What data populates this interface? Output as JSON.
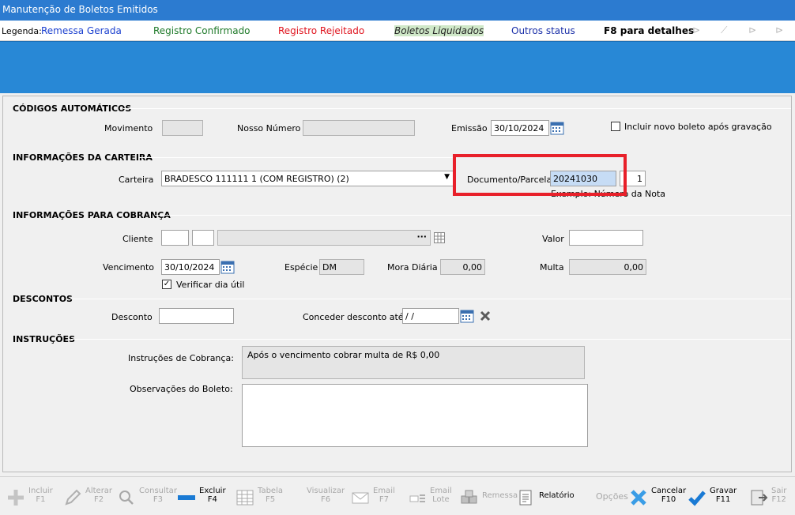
{
  "window": {
    "title": "Manutenção de Boletos Emitidos"
  },
  "legend": {
    "label": "Legenda:",
    "items": [
      {
        "text": "Remessa Gerada",
        "color": "#1a3fcf"
      },
      {
        "text": "Registro Confirmado",
        "color": "#1f7a2a"
      },
      {
        "text": "Registro Rejeitado",
        "color": "#e0141e"
      },
      {
        "text": "Boletos Liquidados",
        "color": "#222222"
      },
      {
        "text": "Outros status",
        "color": "#1a2fa8"
      }
    ],
    "hint": "F8 para detalhes"
  },
  "sections": {
    "codigos": "CÓDIGOS AUTOMÁTICOS",
    "carteira": "INFORMAÇÕES DA CARTEIRA",
    "cobranca": "INFORMAÇÕES PARA COBRANÇA",
    "descontos": "DESCONTOS",
    "instrucoes": "INSTRUÇÕES"
  },
  "fields": {
    "movimento": {
      "label": "Movimento",
      "value": ""
    },
    "nosso_numero": {
      "label": "Nosso Número",
      "value": ""
    },
    "emissao": {
      "label": "Emissão",
      "value": "30/10/2024"
    },
    "incluir_novo": {
      "label": "Incluir novo boleto após gravação",
      "checked": false
    },
    "carteira": {
      "label": "Carteira",
      "value": "BRADESCO  111111 1 (COM REGISTRO)  (2)"
    },
    "documento": {
      "label": "Documento/Parcela",
      "value": "20241030",
      "parcela": "1",
      "hint": "Exemplo: Número da Nota"
    },
    "cliente": {
      "label": "Cliente",
      "code1": "",
      "code2": "",
      "name": "",
      "dots": "···"
    },
    "valor": {
      "label": "Valor",
      "value": ""
    },
    "vencimento": {
      "label": "Vencimento",
      "value": "30/10/2024"
    },
    "especie": {
      "label": "Espécie",
      "value": "DM"
    },
    "mora": {
      "label": "Mora Diária",
      "value": "0,00"
    },
    "multa": {
      "label": "Multa",
      "value": "0,00"
    },
    "verificar": {
      "label": "Verificar dia útil",
      "checked": true
    },
    "desconto": {
      "label": "Desconto",
      "value": ""
    },
    "conceder": {
      "label": "Conceder desconto até",
      "value": " / /"
    },
    "instrucoes_cobranca": {
      "label": "Instruções de Cobrança:",
      "value": "Após o vencimento cobrar multa de R$ 0,00"
    },
    "observacoes": {
      "label": "Observações do Boleto:",
      "value": ""
    }
  },
  "toolbar": [
    {
      "name": "incluir",
      "line1": "Incluir",
      "line2": "F1",
      "icon": "plus-icon",
      "enabled": false
    },
    {
      "name": "alterar",
      "line1": "Alterar",
      "line2": "F2",
      "icon": "pencil-icon",
      "enabled": false
    },
    {
      "name": "consultar",
      "line1": "Consultar",
      "line2": "F3",
      "icon": "search-icon",
      "enabled": false
    },
    {
      "name": "excluir",
      "line1": "Excluir",
      "line2": "F4",
      "icon": "minus-icon",
      "enabled": true
    },
    {
      "name": "tabela",
      "line1": "Tabela",
      "line2": "F5",
      "icon": "table-icon",
      "enabled": false
    },
    {
      "name": "visualizar",
      "line1": "Visualizar",
      "line2": "F6",
      "icon": "",
      "enabled": false
    },
    {
      "name": "email",
      "line1": "Email",
      "line2": "F7",
      "icon": "envelope-icon",
      "enabled": false
    },
    {
      "name": "email-lote",
      "line1": "Email",
      "line2": "Lote",
      "icon": "envelope-list-icon",
      "enabled": false
    },
    {
      "name": "remessa",
      "line1": "Remessa",
      "line2": "",
      "icon": "boxes-icon",
      "enabled": false
    },
    {
      "name": "relatorio",
      "line1": "Relatório",
      "line2": "",
      "icon": "report-icon",
      "enabled": true
    },
    {
      "name": "opcoes",
      "line1": "Opções",
      "line2": "",
      "icon": "",
      "enabled": false
    },
    {
      "name": "cancelar",
      "line1": "Cancelar",
      "line2": "F10",
      "icon": "x-icon",
      "enabled": true
    },
    {
      "name": "gravar",
      "line1": "Gravar",
      "line2": "F11",
      "icon": "check-icon",
      "enabled": true
    },
    {
      "name": "sair",
      "line1": "Sair",
      "line2": "F12",
      "icon": "exit-icon",
      "enabled": false
    }
  ]
}
